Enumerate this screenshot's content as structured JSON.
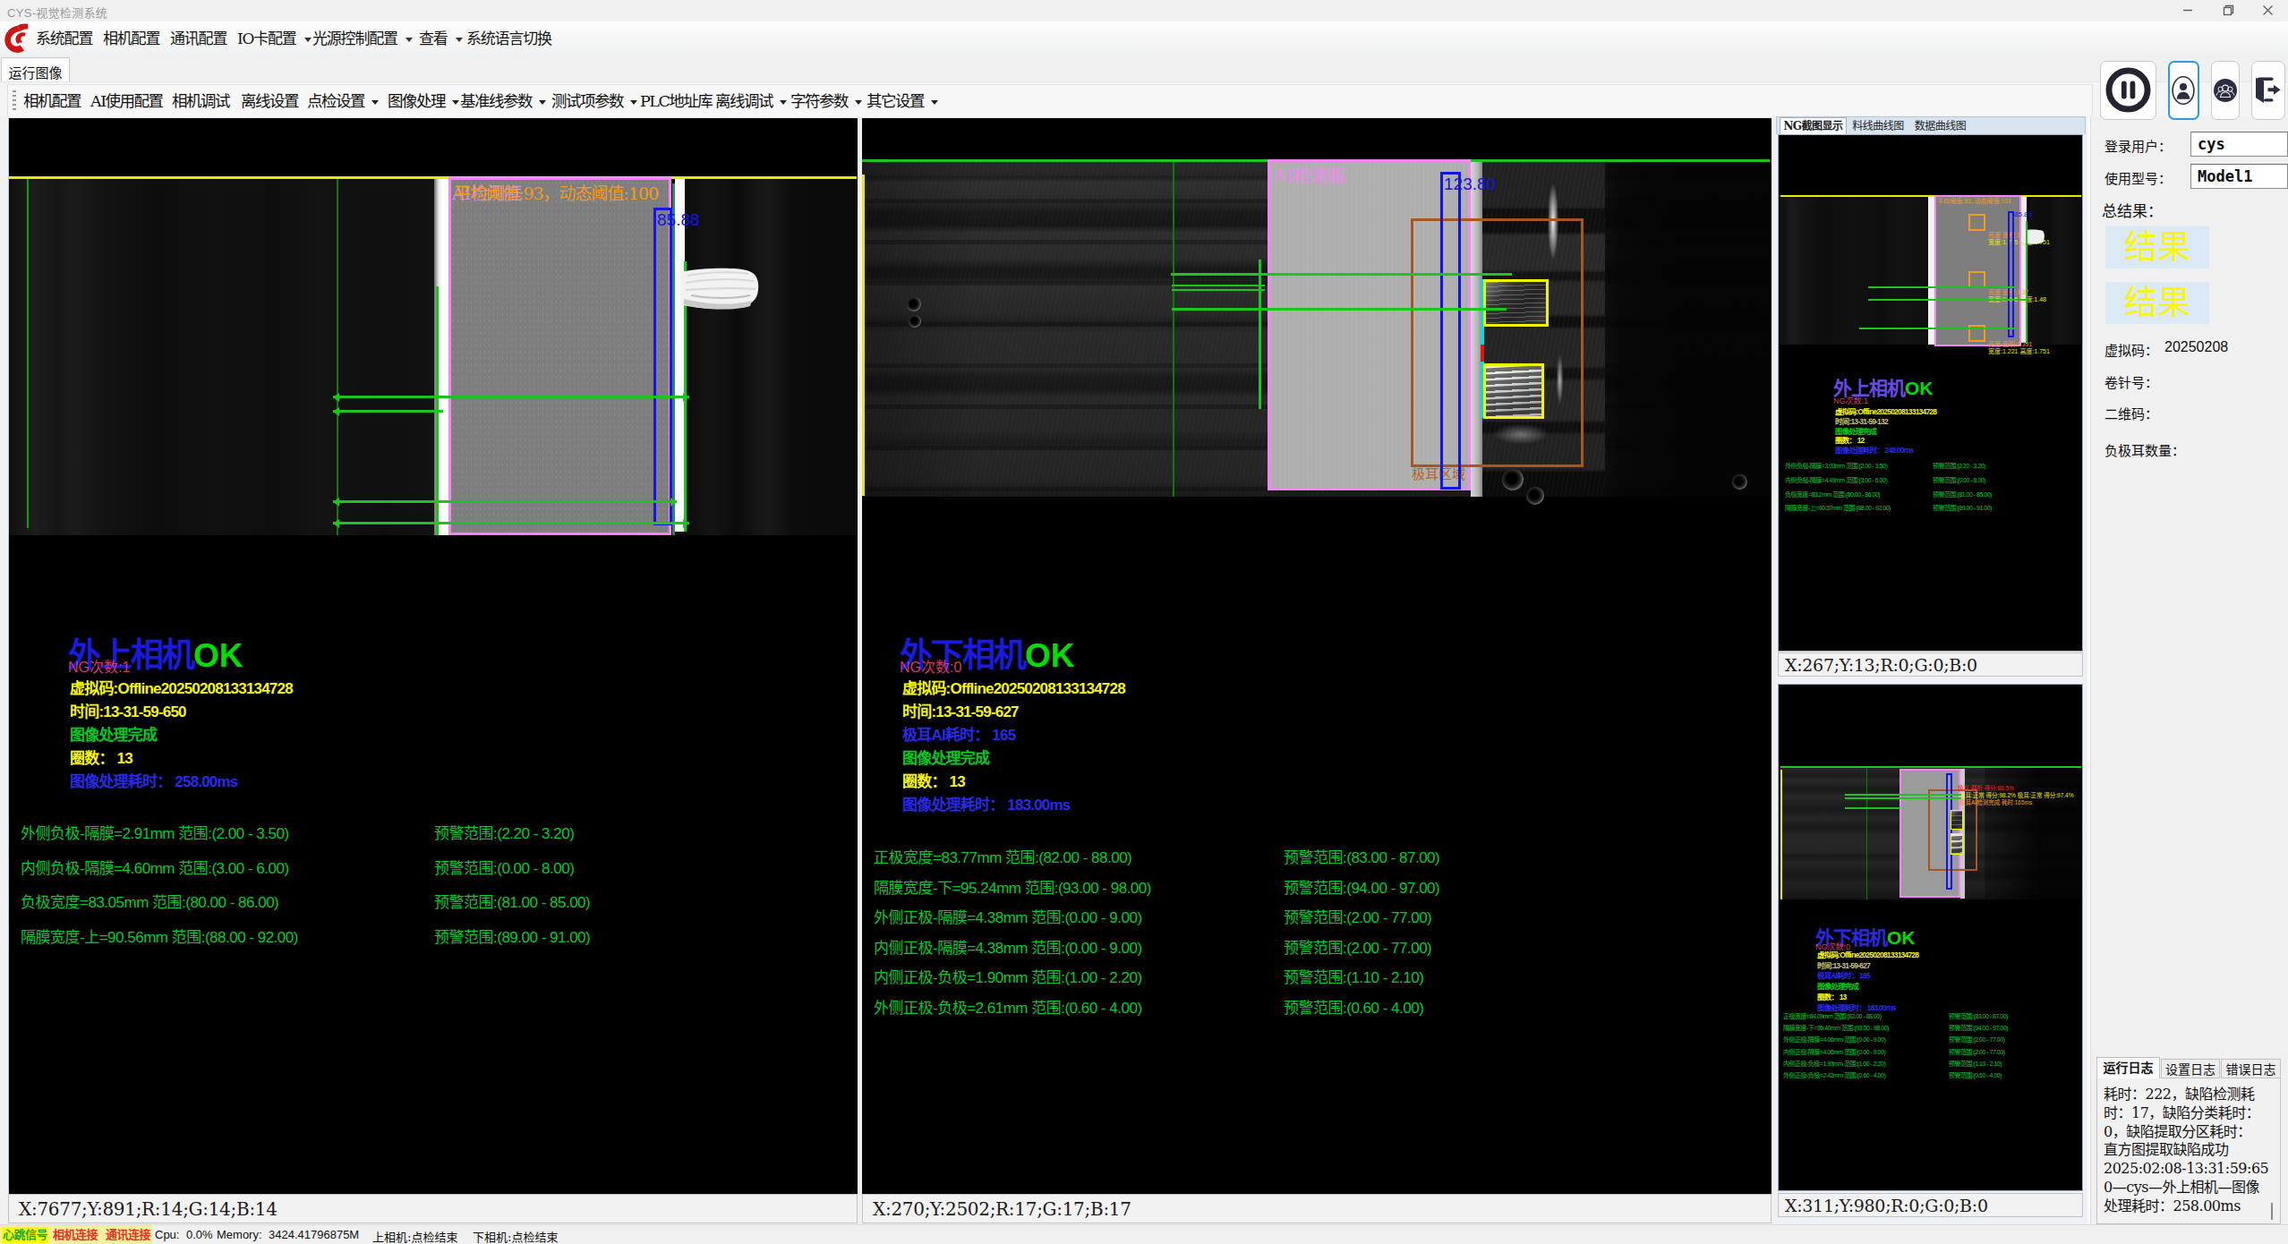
{
  "window": {
    "title": "CYS-视觉检测系统"
  },
  "menu": {
    "items": [
      {
        "label": "系统配置",
        "arrow": false
      },
      {
        "label": "相机配置",
        "arrow": false
      },
      {
        "label": "通讯配置",
        "arrow": false
      },
      {
        "label": "IO卡配置",
        "arrow": true
      },
      {
        "label": "光源控制配置",
        "arrow": true
      },
      {
        "label": "查看",
        "arrow": true
      },
      {
        "label": "系统语言切换",
        "arrow": false
      }
    ]
  },
  "main_tab": "运行图像",
  "toolbar": {
    "items": [
      {
        "label": "相机配置",
        "arrow": false
      },
      {
        "label": "AI使用配置",
        "arrow": false
      },
      {
        "label": "相机调试",
        "arrow": false
      },
      {
        "label": "离线设置",
        "arrow": false
      },
      {
        "label": "点检设置",
        "arrow": true
      },
      {
        "label": "图像处理",
        "arrow": true
      },
      {
        "label": "基准线参数",
        "arrow": true
      },
      {
        "label": "测试项参数",
        "arrow": true
      },
      {
        "label": "PLC地址库",
        "arrow": false
      },
      {
        "label": "离线调试",
        "arrow": true
      },
      {
        "label": "字符参数",
        "arrow": true
      },
      {
        "label": "其它设置",
        "arrow": true
      }
    ]
  },
  "panels": {
    "left": {
      "threshold_label": "平均阈值:93，动态阈值:100",
      "ai_label": "AI检测框",
      "measure_value": "85.88",
      "title": "外上相机",
      "status": "OK",
      "ng": "NG次数:1",
      "lines": [
        {
          "text": "虚拟码:Offline20250208133134728",
          "color": "#f8f800"
        },
        {
          "text": "时间:13-31-59-650",
          "color": "#f8f800"
        },
        {
          "text": "图像处理完成",
          "color": "#00cc22"
        },
        {
          "text": "圈数： 13",
          "color": "#f8f800"
        },
        {
          "text": "图像处理耗时： 258.00ms",
          "color": "#2a2ae8"
        }
      ],
      "measurements": [
        {
          "left": "外侧负极-隔膜=2.91mm 范围:(2.00 - 3.50)",
          "warn": "预警范围:(2.20 - 3.20)"
        },
        {
          "left": "内侧负极-隔膜=4.60mm 范围:(3.00 - 6.00)",
          "warn": "预警范围:(0.00 - 8.00)"
        },
        {
          "left": "负极宽度=83.05mm 范围:(80.00 - 86.00)",
          "warn": "预警范围:(81.00 - 85.00)"
        },
        {
          "left": "隔膜宽度-上=90.56mm 范围:(88.00 - 92.00)",
          "warn": "预警范围:(89.00 - 91.00)"
        }
      ],
      "coords": "X:7677;Y:891;R:14;G:14;B:14"
    },
    "right": {
      "ai_label": "AI检测框",
      "tab_region_label": "极耳区域",
      "measure_value": "123.80",
      "title": "外下相机",
      "status": "OK",
      "ng": "NG次数:0",
      "lines": [
        {
          "text": "虚拟码:Offline20250208133134728",
          "color": "#f8f800"
        },
        {
          "text": "时间:13-31-59-627",
          "color": "#f8f800"
        },
        {
          "text": "极耳AI耗时： 165",
          "color": "#2a2ae8"
        },
        {
          "text": "图像处理完成",
          "color": "#00cc22"
        },
        {
          "text": "圈数： 13",
          "color": "#f8f800"
        },
        {
          "text": "图像处理耗时： 183.00ms",
          "color": "#2a2ae8"
        }
      ],
      "measurements": [
        {
          "left": "正极宽度=83.77mm 范围:(82.00 - 88.00)",
          "warn": "预警范围:(83.00 - 87.00)"
        },
        {
          "left": "隔膜宽度-下=95.24mm 范围:(93.00 - 98.00)",
          "warn": "预警范围:(94.00 - 97.00)"
        },
        {
          "left": "外侧正极-隔膜=4.38mm 范围:(0.00 - 9.00)",
          "warn": "预警范围:(2.00 - 77.00)"
        },
        {
          "left": "内侧正极-隔膜=4.38mm 范围:(0.00 - 9.00)",
          "warn": "预警范围:(2.00 - 77.00)"
        },
        {
          "left": "内侧正极-负极=1.90mm 范围:(1.00 - 2.20)",
          "warn": "预警范围:(1.10 - 2.10)"
        },
        {
          "left": "外侧正极-负极=2.61mm 范围:(0.60 - 4.00)",
          "warn": "预警范围:(0.60 - 4.00)"
        }
      ],
      "coords": "X:270;Y:2502;R:17;G:17;B:17"
    }
  },
  "ng_panel": {
    "tabs": [
      "NG截图显示",
      "料线曲线图",
      "数据曲线图"
    ],
    "thumb1": {
      "threshold_label": "平均阈值:93, 动态阈值:101",
      "measure_value": "85.88",
      "title": "外上相机",
      "status": "OK",
      "ng": "NG次数:1",
      "anno1": "亮度 面积:1.226",
      "anno1b": "宽度:1.775 高度:1.751",
      "anno2": "亮度 面积:1.37",
      "anno2b": "宽度:0.885 高度:1.48",
      "anno3": "亮度 面积:1.391",
      "anno3b": "宽度:1.221 高度:1.751",
      "lines": [
        {
          "text": "虚拟码:Offline20250208133134728",
          "color": "#f8f800"
        },
        {
          "text": "时间:13-31-59-132",
          "color": "#c8c870"
        },
        {
          "text": "图像处理完成",
          "color": "#00cc22"
        },
        {
          "text": "圈数： 12",
          "color": "#f8f800"
        },
        {
          "text": "图像处理耗时： 248.00ms",
          "color": "#2a2ae8"
        }
      ],
      "measurements": [
        {
          "left": "外侧负极-隔膜=3.03mm 范围:(2.00 - 3.50)",
          "warn": "预警范围:(2.20 - 3.20)"
        },
        {
          "left": "内侧负极-隔膜=4.49mm 范围:(3.00 - 6.00)",
          "warn": "预警范围:(0.00 - 8.00)"
        },
        {
          "left": "负极宽度=83.2mm 范围:(80.00 - 86.00)",
          "warn": "预警范围:(81.00 - 85.00)"
        },
        {
          "left": "隔膜宽度-上=90.57mm 范围:(88.00 - 92.00)",
          "warn": "预警范围:(89.00 - 91.00)"
        }
      ],
      "coords": "X:267;Y:13;R:0;G:0;B:0"
    },
    "thumb2": {
      "title": "外下相机",
      "status": "OK",
      "ng": "NG次数:0",
      "anno_red": "极耳:翻折 得分:86.5%",
      "anno_yellow": "极耳:正常 得分:98.2% 极耳:正常 得分:97.4%",
      "anno_orange": "极耳AI检测完成 耗时:165ms",
      "lines": [
        {
          "text": "虚拟码:Offline20250208133134728",
          "color": "#f8f800"
        },
        {
          "text": "时间:13-31-59-627",
          "color": "#c8c870"
        },
        {
          "text": "极耳AI耗时： 165",
          "color": "#2a2ae8"
        },
        {
          "text": "图像处理完成",
          "color": "#00cc22"
        },
        {
          "text": "圈数： 13",
          "color": "#f8f800"
        },
        {
          "text": "图像处理耗时： 183.00ms",
          "color": "#2a2ae8"
        }
      ],
      "measurements": [
        {
          "left": "正极宽度=84.09mm 范围:(82.00 - 88.00)",
          "warn": "预警范围:(83.00 - 87.00)"
        },
        {
          "left": "隔膜宽度-下=95.40mm 范围:(93.00 - 98.00)",
          "warn": "预警范围:(94.00 - 97.00)"
        },
        {
          "left": "外侧正极-隔膜=4.06mm 范围:(0.00 - 9.00)",
          "warn": "预警范围:(2.00 - 77.00)"
        },
        {
          "left": "内侧正极-隔膜=4.06mm 范围:(0.00 - 9.00)",
          "warn": "预警范围:(2.00 - 77.00)"
        },
        {
          "left": "内侧正极-负极=1.93mm 范围:(1.00 - 2.20)",
          "warn": "预警范围:(1.10 - 2.10)"
        },
        {
          "left": "外侧正极-负极=2.42mm 范围:(0.60 - 4.00)",
          "warn": "预警范围:(0.60 - 4.00)"
        }
      ],
      "coords": "X:311;Y:980;R:0;G:0;B:0"
    }
  },
  "sidebar": {
    "login_label": "登录用户：",
    "login_value": "cys",
    "model_label": "使用型号：",
    "model_value": "Model1",
    "result_label": "总结果：",
    "result1": "结果",
    "result2": "结果",
    "vcode_label": "虚拟码：",
    "vcode_value": "20250208",
    "reel_label": "卷针号：",
    "reel_value": "",
    "qr_label": "二维码：",
    "qr_value": "",
    "tab_count_label": "负极耳数量：",
    "tab_count_value": "",
    "log_tabs": [
      "运行日志",
      "设置日志",
      "错误日志"
    ],
    "log_lines": [
      "耗时：222，缺陷检测耗",
      "时：17，缺陷分类耗时：",
      "0，缺陷提取分区耗时：",
      "直方图提取缺陷成功",
      "2025:02:08-13:31:59:65",
      "0—cys—外上相机—图像",
      "处理耗时：258.00ms"
    ]
  },
  "statusbar": {
    "heart": "心跳信号",
    "cam": "相机连接",
    "comm": "通讯连接",
    "cpu_label": "Cpu:",
    "cpu_value": "0.0%",
    "mem_label": "Memory:",
    "mem_value": "3424.41796875M",
    "cam_top": "上相机:点检结束",
    "cam_bottom": "下相机:点检结束"
  },
  "colors": {
    "accent_blue": "#1515e8",
    "ok_green": "#00dd00",
    "warn_yellow": "#f8f800",
    "pink": "#f584f8",
    "orange": "#ff9c00",
    "box_blue": "#1414e6",
    "line_green": "#23c523",
    "sienna": "#a8561f",
    "cyan": "#00e8e8"
  }
}
